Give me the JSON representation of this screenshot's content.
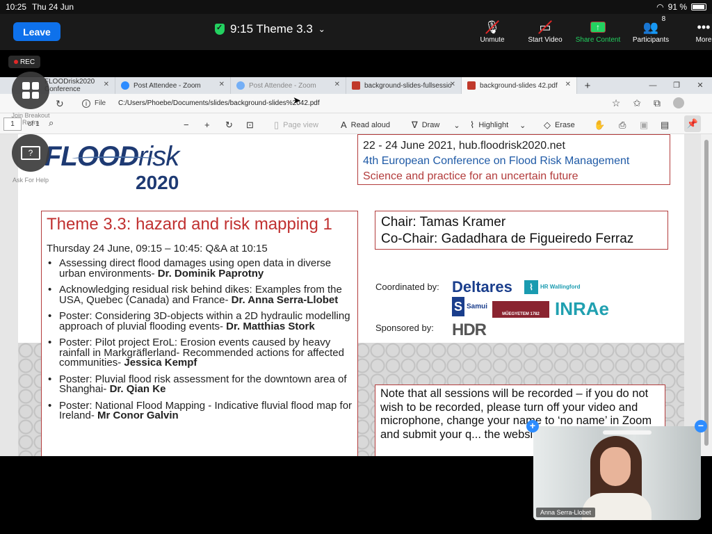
{
  "status_bar": {
    "time": "10:25",
    "date": "Thu 24 Jun",
    "battery": "91 %"
  },
  "zoom": {
    "leave_label": "Leave",
    "meeting_title": "9:15 Theme 3.3",
    "controls": [
      {
        "label": "Unmute",
        "icon": "microphone-muted-icon"
      },
      {
        "label": "Start Video",
        "icon": "video-off-icon"
      },
      {
        "label": "Share Content",
        "icon": "share-icon"
      },
      {
        "label": "Participants",
        "icon": "participants-icon",
        "count": "8"
      },
      {
        "label": "More",
        "icon": "more-icon"
      }
    ],
    "rec_label": "REC",
    "side_buttons": [
      {
        "label": "Join Breakout Room",
        "icon": "grid-icon"
      },
      {
        "label": "Ask For Help",
        "icon": "help-icon"
      }
    ],
    "accent": "#0e71eb",
    "share_color": "#23d160"
  },
  "browser": {
    "tabs": [
      {
        "title": "FLOODrisk2020 Conference",
        "icon": "edge-icon"
      },
      {
        "title": "Post Attendee - Zoom",
        "icon": "zoom-icon"
      },
      {
        "title": "Post Attendee - Zoom",
        "icon": "zoom-icon"
      },
      {
        "title": "background-slides-fullsessio",
        "icon": "pdf-icon"
      },
      {
        "title": "background-slides 42.pdf",
        "icon": "pdf-icon"
      }
    ],
    "file_label": "File",
    "url": "C:/Users/Phoebe/Documents/slides/background-slides%2042.pdf",
    "page_current": "1",
    "page_total": "of 1",
    "toolbar": {
      "page_view": "Page view",
      "read_aloud": "Read aloud",
      "draw": "Draw",
      "highlight": "Highlight",
      "erase": "Erase"
    }
  },
  "slide": {
    "logo": {
      "word1": "FLOOD",
      "word2": "risk",
      "year": "2020"
    },
    "conference": {
      "line1": "22 - 24 June 2021, hub.floodrisk2020.net",
      "line2": "4th European Conference on Flood Risk Management",
      "line3": "Science and practice for an uncertain future"
    },
    "theme_title": "Theme 3.3: hazard and risk mapping 1",
    "session_time": "Thursday 24 June, 09:15 – 10:45: Q&A at 10:15",
    "talks": [
      {
        "text": "Assessing direct flood damages using open data in diverse urban environments- ",
        "speaker": "Dr. Dominik Paprotny"
      },
      {
        "text": "Acknowledging residual risk behind dikes: Examples from the USA, Quebec (Canada) and France- ",
        "speaker": "Dr. Anna Serra-Llobet"
      },
      {
        "text": "Poster: Considering 3D-objects within a 2D hydraulic modelling approach of pluvial flooding events- ",
        "speaker": "Dr. Matthias Stork"
      },
      {
        "text": "Poster: Pilot project EroL: Erosion events caused by heavy rainfall in Markgräflerland- Recommended actions for affected communities- ",
        "speaker": "Jessica Kempf"
      },
      {
        "text": "Poster: Pluvial flood risk assessment for the downtown area of Shanghai- ",
        "speaker": "Dr. Qian Ke"
      },
      {
        "text": "Poster: National Flood Mapping - Indicative fluvial flood map for Ireland- ",
        "speaker": "Mr Conor Galvin"
      }
    ],
    "chair": "Chair: Tamas Kramer",
    "co_chair": "Co-Chair: Gadadhara de Figueiredo Ferraz",
    "coordinated_by": "Coordinated by:",
    "sponsored_by": "Sponsored by:",
    "logos": {
      "deltares": "Deltares",
      "hr_wallingford": "HR Wallingford",
      "samui": "Samui",
      "muegyetem": "MŰEGYETEM 1782",
      "inrae": "INRAe",
      "hdr": "HDR"
    },
    "note": "Note that all sessions will be recorded – if you do not wish to be recorded, please turn off your video and microphone, change your name to ‘no name’ in Zoom and submit your q... the website or in the Zoom c..."
  },
  "video": {
    "participant_name": "Anna Serra-Llobet"
  }
}
